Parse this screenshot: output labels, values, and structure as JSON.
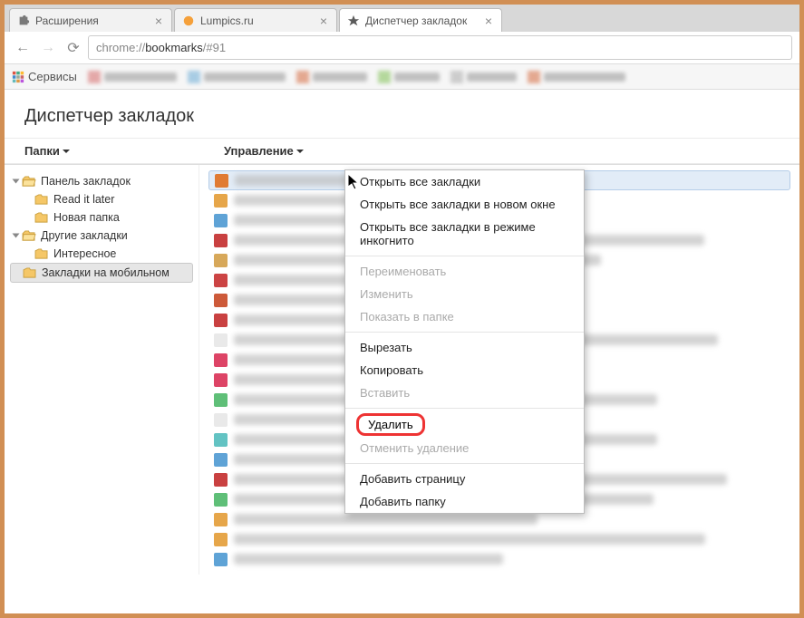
{
  "tabs": [
    {
      "title": "Расширения",
      "icon": "puzzle"
    },
    {
      "title": "Lumpics.ru",
      "icon": "orange"
    },
    {
      "title": "Диспетчер закладок",
      "icon": "star",
      "active": true
    }
  ],
  "url_prefix": "chrome://",
  "url_bold": "bookmarks",
  "url_suffix": "/#91",
  "bookmarks_bar": {
    "services": "Сервисы"
  },
  "page_title": "Диспетчер закладок",
  "toolbar": {
    "folders": "Папки",
    "manage": "Управление"
  },
  "tree": [
    {
      "label": "Панель закладок",
      "type": "open",
      "lvl": 0
    },
    {
      "label": "Read it later",
      "type": "folder",
      "lvl": 1
    },
    {
      "label": "Новая папка",
      "type": "folder",
      "lvl": 1
    },
    {
      "label": "Другие закладки",
      "type": "open",
      "lvl": 0
    },
    {
      "label": "Интересное",
      "type": "folder",
      "lvl": 1
    },
    {
      "label": "Закладки на мобильном",
      "type": "folder",
      "lvl": 0,
      "selected": true
    }
  ],
  "list_rows": [
    {
      "c": "#e07b33",
      "sel": true
    },
    {
      "c": "#e6a64a"
    },
    {
      "c": "#5fa3d6"
    },
    {
      "c": "#c94141"
    },
    {
      "c": "#d7a85a"
    },
    {
      "c": "#c44"
    },
    {
      "c": "#cd5a3a"
    },
    {
      "c": "#c94141"
    },
    {
      "c": "#e9e9e9"
    },
    {
      "c": "#d46"
    },
    {
      "c": "#d46"
    },
    {
      "c": "#5fbf78"
    },
    {
      "c": "#e9e9e9"
    },
    {
      "c": "#63c3c3"
    },
    {
      "c": "#5fa3d6"
    },
    {
      "c": "#c94141"
    },
    {
      "c": "#5fbf78"
    },
    {
      "c": "#e6a64a"
    },
    {
      "c": "#e6a64a"
    },
    {
      "c": "#5fa3d6"
    }
  ],
  "menu": [
    {
      "t": "Открыть все закладки"
    },
    {
      "t": "Открыть все закладки в новом окне"
    },
    {
      "t": "Открыть все закладки в режиме инкогнито"
    },
    {
      "sep": true
    },
    {
      "t": "Переименовать",
      "dis": true
    },
    {
      "t": "Изменить",
      "dis": true
    },
    {
      "t": "Показать в папке",
      "dis": true
    },
    {
      "sep": true
    },
    {
      "t": "Вырезать"
    },
    {
      "t": "Копировать"
    },
    {
      "t": "Вставить",
      "dis": true
    },
    {
      "sep": true
    },
    {
      "t": "Удалить",
      "hl": true
    },
    {
      "t": "Отменить удаление",
      "dis": true
    },
    {
      "sep": true
    },
    {
      "t": "Добавить страницу"
    },
    {
      "t": "Добавить папку"
    }
  ]
}
